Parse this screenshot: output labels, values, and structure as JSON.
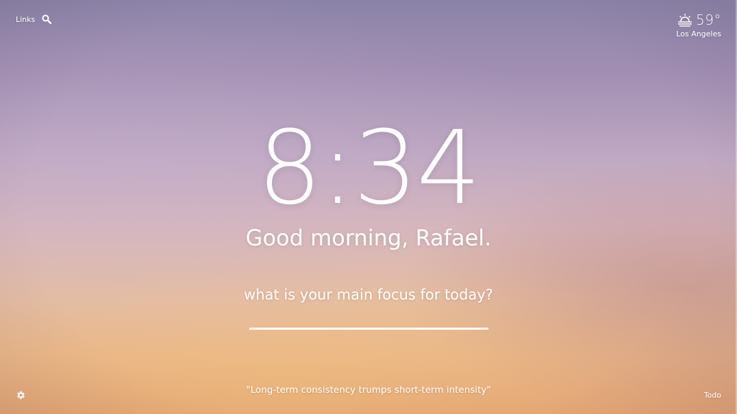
{
  "top_left": {
    "links_label": "Links",
    "search_icon": "search-icon"
  },
  "weather": {
    "icon": "sunrise-icon",
    "temperature": "59°",
    "location": "Los Angeles"
  },
  "clock": {
    "time": "8:34"
  },
  "greeting": {
    "text": "Good morning, Rafael."
  },
  "focus": {
    "prompt": "what is your main focus for today?",
    "value": "",
    "placeholder": ""
  },
  "quote": {
    "text": "\"Long-term consistency trumps short-term intensity\""
  },
  "footer": {
    "settings_icon": "gear-icon",
    "todo_label": "Todo"
  },
  "colors": {
    "text": "#ffffff",
    "sky_top": "#8b83a8",
    "sky_bottom": "#e2a274"
  }
}
